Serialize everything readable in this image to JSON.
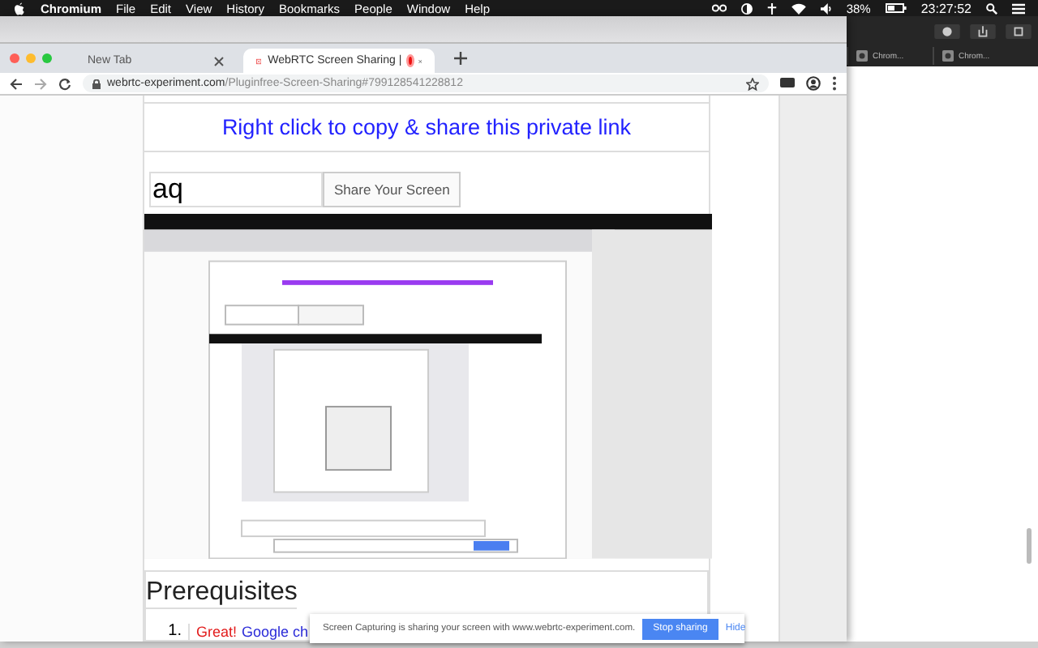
{
  "menu_bar": {
    "app": "Chromium",
    "items": [
      "File",
      "Edit",
      "View",
      "History",
      "Bookmarks",
      "People",
      "Window",
      "Help"
    ],
    "battery": "38%",
    "clock": "23:27:52"
  },
  "tabs": [
    {
      "label": "New Tab",
      "selected": false,
      "recording": false
    },
    {
      "label": "WebRTC Screen Sharing |",
      "selected": true,
      "recording": true
    }
  ],
  "background_tabs": [
    "Chrom...",
    "Chrom..."
  ],
  "address": {
    "domain": "webrtc-experiment.com",
    "path": "/Pluginfree-Screen-Sharing#799128541228812"
  },
  "page": {
    "link": "Right click to copy & share this private link",
    "room_field": {
      "value": "aq"
    },
    "share_button": "Share Your Screen",
    "heading": "Prerequisites",
    "list": [
      {
        "number": "1.",
        "parts": [
          {
            "text": "Great!",
            "color": "#e21b1b"
          },
          {
            "text": "Google ch",
            "color": "#2b2bd8"
          }
        ]
      }
    ]
  },
  "sharing_bar": {
    "message": "Screen Capturing is sharing your screen with www.webrtc-experiment.com.",
    "stop_button": "Stop sharing",
    "hide_link": "Hide"
  }
}
